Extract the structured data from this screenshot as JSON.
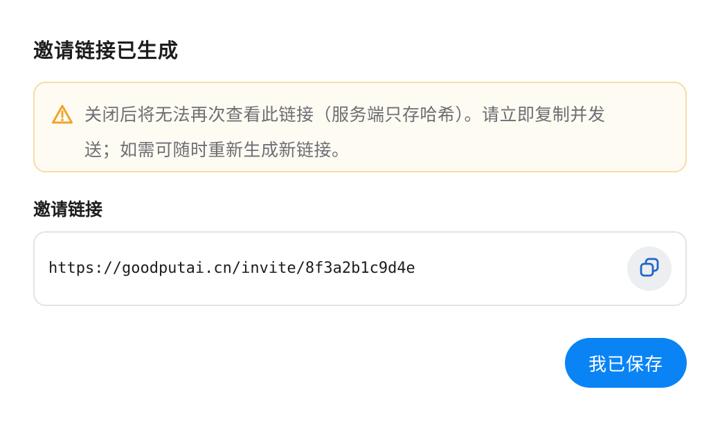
{
  "dialog": {
    "title": "邀请链接已生成",
    "warning": {
      "icon": "warning-triangle-icon",
      "line1": "关闭后将无法再次查看此链接（服务端只存哈希）。请立即复制并发",
      "line2": "送；如需可随时重新生成新链接。",
      "accent_color": "#f0a429"
    },
    "link_field": {
      "label": "邀请链接",
      "value": "https://goodputai.cn/invite/8f3a2b1c9d4e",
      "copy_icon": "copy-icon"
    },
    "confirm_button": {
      "label": "我已保存",
      "color": "#0a84f5"
    }
  }
}
